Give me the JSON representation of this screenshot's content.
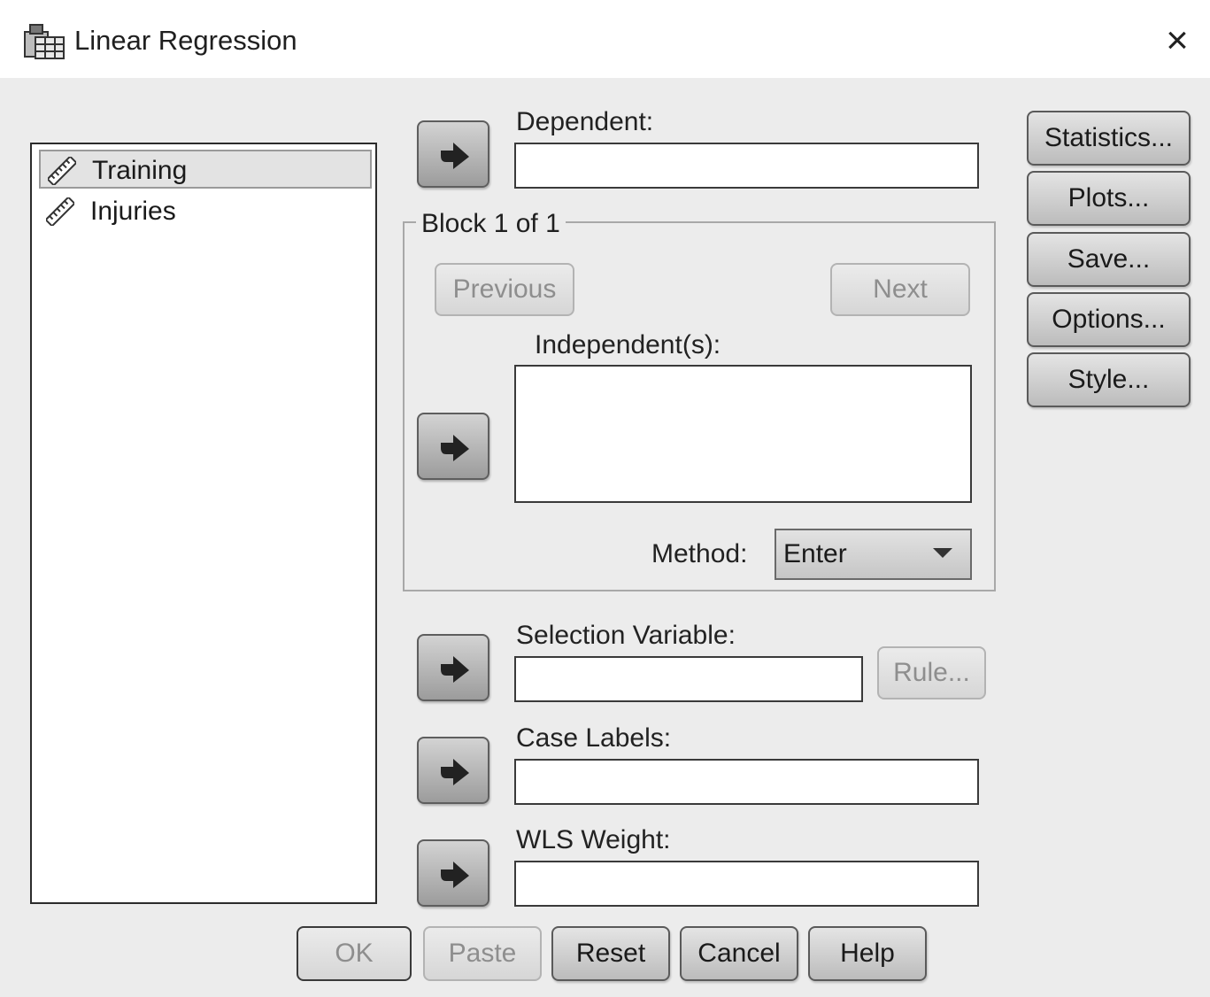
{
  "window": {
    "title": "Linear Regression",
    "icon": "linear-regression-app-icon",
    "close_icon": "×"
  },
  "variables": [
    {
      "label": "Training",
      "icon": "ruler-scale-icon",
      "selected": true
    },
    {
      "label": "Injuries",
      "icon": "ruler-scale-icon",
      "selected": false
    }
  ],
  "fields": {
    "dependent": {
      "label": "Dependent:",
      "value": ""
    },
    "independents": {
      "label": "Independent(s):",
      "items": []
    },
    "selection_variable": {
      "label": "Selection Variable:",
      "value": ""
    },
    "case_labels": {
      "label": "Case Labels:",
      "value": ""
    },
    "wls_weight": {
      "label": "WLS Weight:",
      "value": ""
    }
  },
  "block": {
    "title": "Block 1 of 1",
    "previous_label": "Previous",
    "next_label": "Next",
    "method_label": "Method:",
    "method_value": "Enter"
  },
  "rule_label": "Rule...",
  "side_buttons": {
    "statistics": "Statistics...",
    "plots": "Plots...",
    "save": "Save...",
    "options": "Options...",
    "style": "Style..."
  },
  "bottom_buttons": {
    "ok": "OK",
    "paste": "Paste",
    "reset": "Reset",
    "cancel": "Cancel",
    "help": "Help"
  },
  "colors": {
    "dialog_bg": "#ececec",
    "titlebar_bg": "#ffffff",
    "disabled_text": "#8e8e8e"
  }
}
